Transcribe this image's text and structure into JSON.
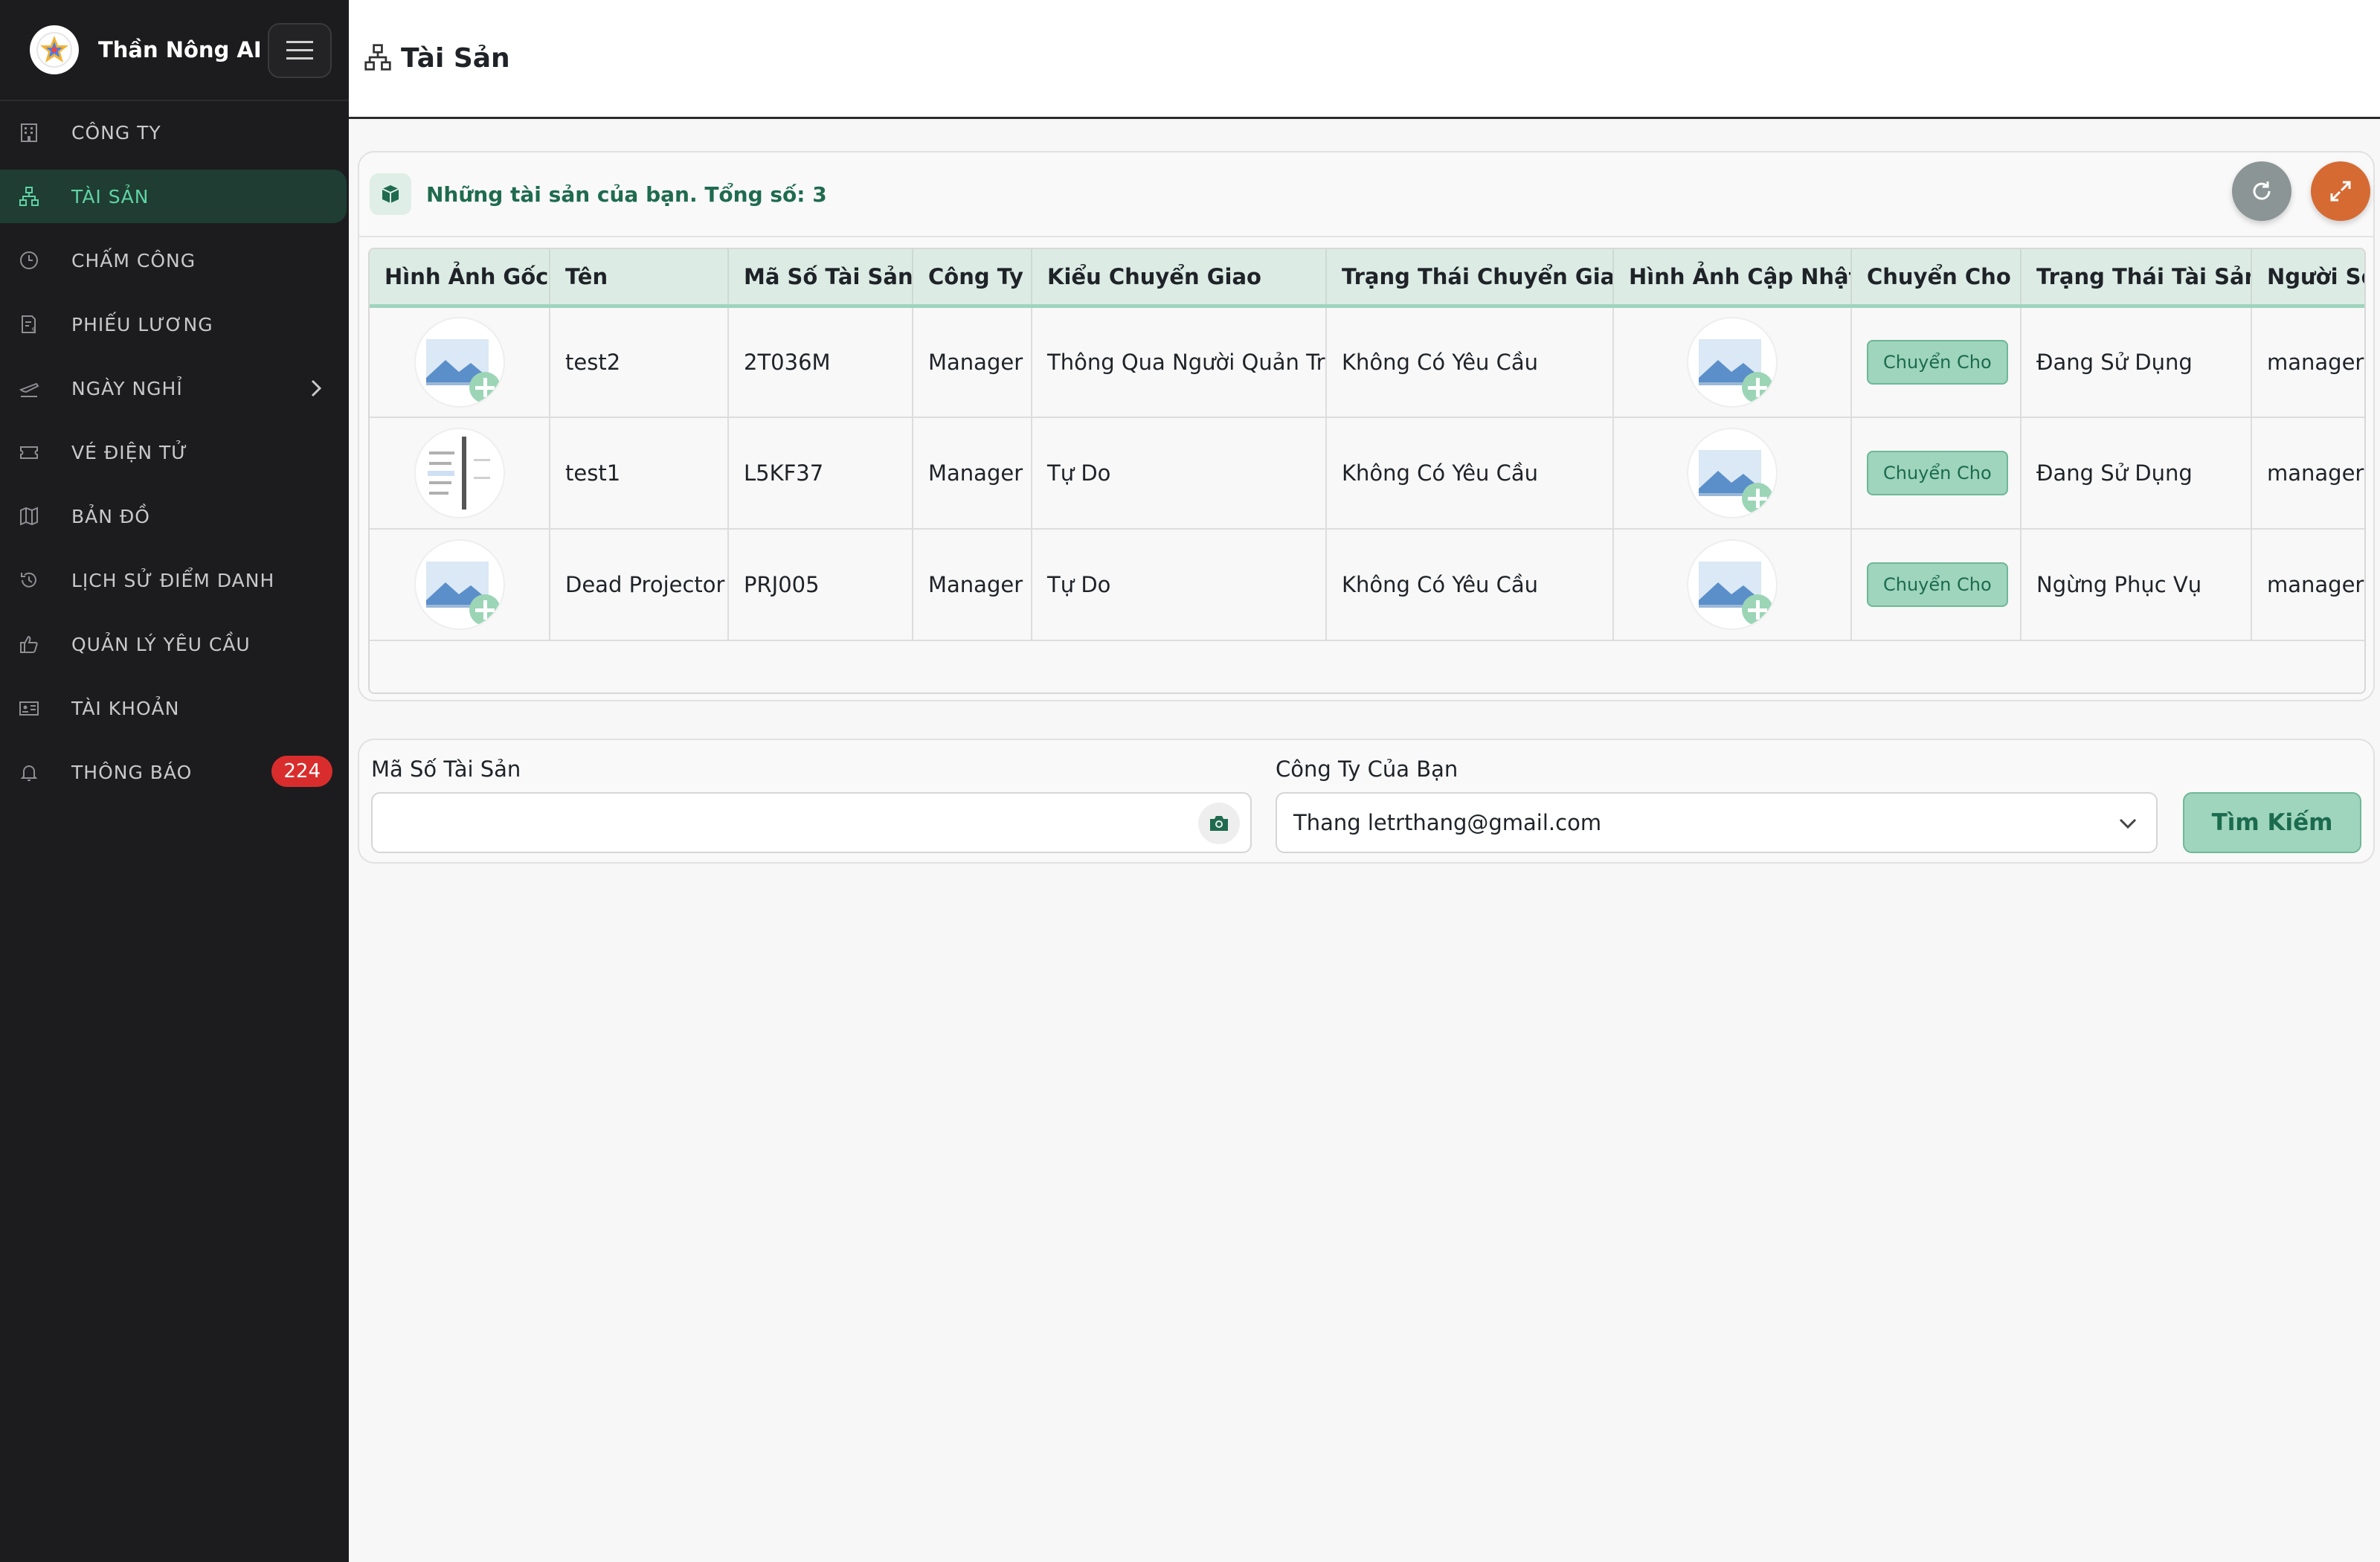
{
  "app": {
    "brand_name": "Thần Nông AI",
    "header_title": "Tài Sản"
  },
  "sidebar": {
    "items": [
      {
        "label": "CÔNG TY",
        "icon": "building-icon",
        "active": false
      },
      {
        "label": "TÀI SẢN",
        "icon": "sitemap-icon",
        "active": true
      },
      {
        "label": "CHẤM CÔNG",
        "icon": "clock-icon",
        "active": false
      },
      {
        "label": "PHIẾU LƯƠNG",
        "icon": "payslip-icon",
        "active": false
      },
      {
        "label": "NGÀY NGHỈ",
        "icon": "plane-icon",
        "active": false
      },
      {
        "label": "VÉ ĐIỆN TỬ",
        "icon": "ticket-icon",
        "active": false
      },
      {
        "label": "BẢN ĐỒ",
        "icon": "map-icon",
        "active": false
      },
      {
        "label": "LỊCH SỬ ĐIỂM DANH",
        "icon": "history-icon",
        "active": false
      },
      {
        "label": "QUẢN LÝ YÊU CẦU",
        "icon": "thumbs-up-icon",
        "active": false
      },
      {
        "label": "TÀI KHOẢN",
        "icon": "id-card-icon",
        "active": false
      },
      {
        "label": "THÔNG BÁO",
        "icon": "bell-icon",
        "active": false,
        "badge": "224"
      }
    ]
  },
  "assets": {
    "title": "Những tài sản của bạn. Tổng số: 3",
    "columns": [
      "Hình Ảnh Gốc",
      "Tên",
      "Mã Số Tài Sản",
      "Công Ty",
      "Kiểu Chuyển Giao",
      "Trạng Thái Chuyển Giao",
      "Hình Ảnh Cập Nhật",
      "Chuyển Cho",
      "Trạng Thái Tài Sản",
      "Người Sở"
    ],
    "rows": [
      {
        "name": "test2",
        "code": "2T036M",
        "company": "Manager",
        "transfer_type": "Thông Qua Người Quản Trị",
        "transfer_status": "Không Có Yêu Cầu",
        "action": "Chuyển Cho",
        "asset_status": "Đang Sử Dụng",
        "owner": "manager@"
      },
      {
        "name": "test1",
        "code": "L5KF37",
        "company": "Manager",
        "transfer_type": "Tự Do",
        "transfer_status": "Không Có Yêu Cầu",
        "action": "Chuyển Cho",
        "asset_status": "Đang Sử Dụng",
        "owner": "manager@"
      },
      {
        "name": "Dead Projector",
        "code": "PRJ005",
        "company": "Manager",
        "transfer_type": "Tự Do",
        "transfer_status": "Không Có Yêu Cầu",
        "action": "Chuyển Cho",
        "asset_status": "Ngừng Phục Vụ",
        "owner": "manager@"
      }
    ]
  },
  "search": {
    "code_label": "Mã Số Tài Sản",
    "code_value": "",
    "company_label": "Công Ty Của Bạn",
    "company_value": "Thang letrthang@gmail.com",
    "button_label": "Tìm Kiếm"
  },
  "colors": {
    "sidebar_bg": "#1c1c1e",
    "accent": "#5fd3a5",
    "accent_bg": "#1f3d33",
    "badge": "#d92d2d",
    "button_green": "#9fd4bd"
  }
}
